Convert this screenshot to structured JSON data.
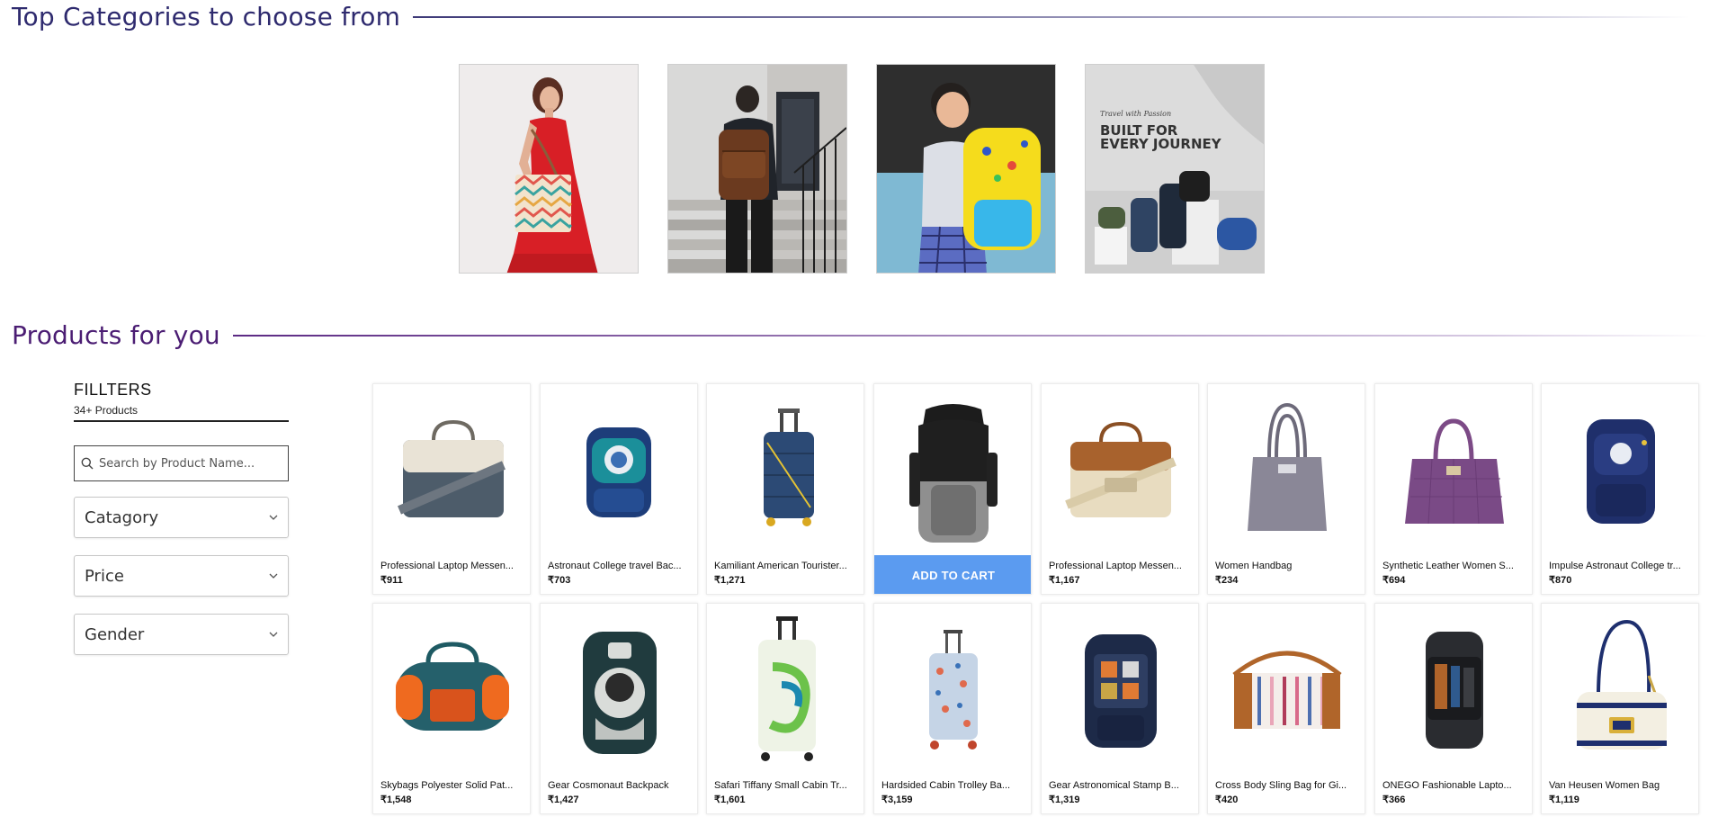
{
  "categories_section": {
    "title": "Top Categories to choose from",
    "tiles": [
      {
        "name": "women-tote-bag-tile"
      },
      {
        "name": "leather-backpack-tile"
      },
      {
        "name": "kids-school-bag-tile"
      },
      {
        "name": "travel-bags-tile",
        "heading": "BUILT FOR\nEVERY JOURNEY",
        "script_text": "Travel with Passion"
      }
    ]
  },
  "products_section": {
    "title": "Products for you"
  },
  "filters": {
    "title": "FILLTERS",
    "count": "34+ Products",
    "search_placeholder": "Search by Product Name...",
    "dropdowns": [
      "Catagory",
      "Price",
      "Gender"
    ]
  },
  "add_to_cart_label": "ADD TO CART",
  "products": [
    {
      "name": "Professional Laptop Messen...",
      "price": "₹911"
    },
    {
      "name": "Astronaut College travel Bac...",
      "price": "₹703"
    },
    {
      "name": "Kamiliant American Tourister...",
      "price": "₹1,271"
    },
    {
      "name": "",
      "price": "",
      "hovered": true
    },
    {
      "name": "Professional Laptop Messen...",
      "price": "₹1,167"
    },
    {
      "name": "Women Handbag",
      "price": "₹234"
    },
    {
      "name": "Synthetic Leather Women S...",
      "price": "₹694"
    },
    {
      "name": "Impulse Astronaut College tr...",
      "price": "₹870"
    },
    {
      "name": "Skybags Polyester Solid Pat...",
      "price": "₹1,548"
    },
    {
      "name": "Gear Cosmonaut Backpack",
      "price": "₹1,427"
    },
    {
      "name": "Safari Tiffany Small Cabin Tr...",
      "price": "₹1,601"
    },
    {
      "name": "Hardsided Cabin Trolley Ba...",
      "price": "₹3,159"
    },
    {
      "name": "Gear Astronomical Stamp B...",
      "price": "₹1,319"
    },
    {
      "name": "Cross Body Sling Bag for Gi...",
      "price": "₹420"
    },
    {
      "name": "ONEGO Fashionable Lapto...",
      "price": "₹366"
    },
    {
      "name": "Van Heusen Women Bag",
      "price": "₹1,119"
    }
  ],
  "colors": {
    "categories_title": "#2e2a6e",
    "products_title": "#4b1d73",
    "add_to_cart": "#5b9bf0"
  }
}
